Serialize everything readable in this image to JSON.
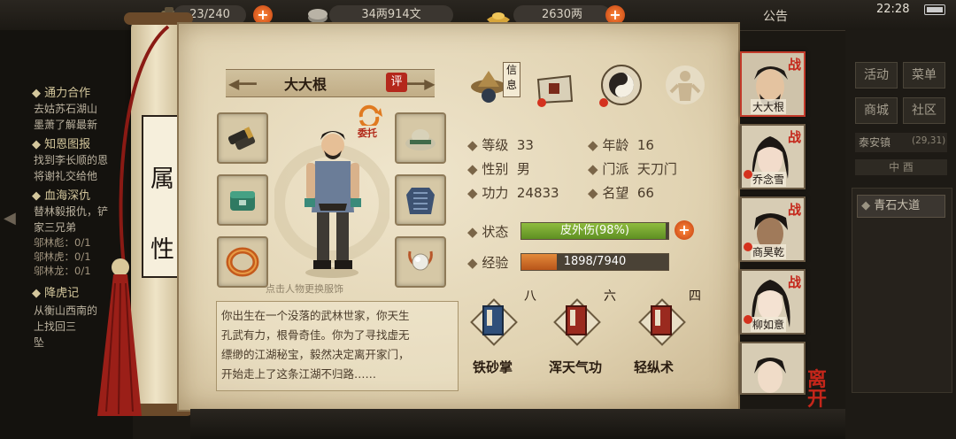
{
  "topbar": {
    "bag_count": "23/240",
    "money": "34两914文",
    "gold": "2630两",
    "notice": "公告",
    "clock": "22:28"
  },
  "left_quests": [
    {
      "title": "通力合作",
      "lines": [
        "去姑苏石湖山",
        "墨萧了解最新"
      ]
    },
    {
      "title": "知恩图报",
      "lines": [
        "找到李长顺的恩",
        "将谢礼交给他"
      ]
    },
    {
      "title": "血海深仇",
      "lines": [
        "替林毅报仇，铲",
        "家三兄弟"
      ],
      "progress": [
        "邬林彪：0/1",
        "邬林虎：0/1",
        "邬林龙：0/1"
      ]
    },
    {
      "title": "降虎记",
      "lines": [
        "从衡山西南的",
        "上找回三",
        "坠"
      ]
    }
  ],
  "scroll_label": [
    "属",
    "性"
  ],
  "character": {
    "name": "大大根",
    "ping": "评",
    "entrust": "委托",
    "hint": "点击人物更换服饰",
    "bio": [
      "你出生在一个没落的武林世家，你天生",
      "孔武有力，根骨奇佳。你为了寻找虚无",
      "缥缈的江湖秘宝，毅然决定离开家门，",
      "开始走上了这条江湖不归路……"
    ]
  },
  "tabs": {
    "info_label": "信息"
  },
  "stats": {
    "level_label": "等级",
    "level": "33",
    "age_label": "年龄",
    "age": "16",
    "gender_label": "性别",
    "gender": "男",
    "sect_label": "门派",
    "sect": "天刀门",
    "power_label": "功力",
    "power": "24833",
    "fame_label": "名望",
    "fame": "66",
    "state_label": "状态",
    "state": "皮外伤(98%)",
    "state_value": 0.98,
    "exp_label": "经验",
    "exp": "1898/7940",
    "exp_value": 0.239
  },
  "skills": [
    {
      "name": "铁砂掌",
      "grade": "八",
      "color": "#2f4f7a"
    },
    {
      "name": "浑天气功",
      "grade": "六",
      "color": "#9a2a1f"
    },
    {
      "name": "轻纵术",
      "grade": "四",
      "color": "#9a2a1f"
    }
  ],
  "party": [
    {
      "name": "大大根",
      "zhan": "战"
    },
    {
      "name": "乔念雪",
      "zhan": "战"
    },
    {
      "name": "商昊乾",
      "zhan": "战"
    },
    {
      "name": "柳如意",
      "zhan": "战"
    },
    {
      "name": "",
      "zhan": ""
    }
  ],
  "leave": "离开",
  "right_panel": {
    "buttons": [
      "活动",
      "菜单",
      "商城",
      "社区"
    ],
    "location": "泰安镇",
    "coords": "(29,31)",
    "time": "中 酉",
    "road": "青石大道"
  }
}
